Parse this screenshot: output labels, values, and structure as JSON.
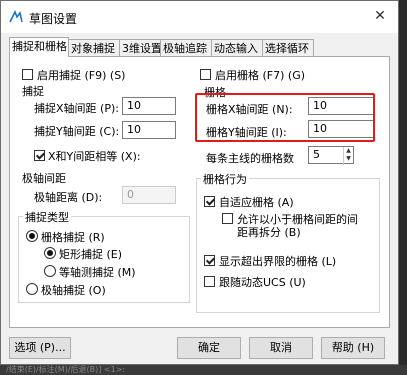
{
  "window": {
    "title": "草图设置",
    "close_label": "✕",
    "icon": "drafting-settings-icon"
  },
  "tabs": [
    {
      "label": "捕捉和栅格",
      "active": true
    },
    {
      "label": "对象捕捉",
      "active": false
    },
    {
      "label": "3维设置",
      "active": false
    },
    {
      "label": "极轴追踪",
      "active": false
    },
    {
      "label": "动态输入",
      "active": false
    },
    {
      "label": "选择循环",
      "active": false
    }
  ],
  "snap": {
    "enable_label": "启用捕捉 (F9) (S)",
    "enabled": false,
    "group_title": "捕捉",
    "x_spacing_label": "捕捉X轴间距 (P):",
    "x_spacing_value": "10",
    "y_spacing_label": "捕捉Y轴间距 (C):",
    "y_spacing_value": "10",
    "equal_label": "X和Y间距相等 (X):",
    "equal_checked": true
  },
  "polar": {
    "group_title": "极轴间距",
    "distance_label": "极轴距离 (D):",
    "distance_value": "0"
  },
  "snap_type": {
    "group_title": "捕捉类型",
    "grid_snap_label": "栅格捕捉 (R)",
    "rect_snap_label": "矩形捕捉 (E)",
    "iso_snap_label": "等轴测捕捉 (M)",
    "polar_snap_label": "极轴捕捉 (O)"
  },
  "grid": {
    "enable_label": "启用栅格 (F7) (G)",
    "enabled": false,
    "group_title": "栅格",
    "x_spacing_label": "栅格X轴间距 (N):",
    "x_spacing_value": "10",
    "y_spacing_label": "栅格Y轴间距 (I):",
    "y_spacing_value": "10",
    "major_label": "每条主线的栅格数",
    "major_value": "5"
  },
  "grid_behavior": {
    "group_title": "栅格行为",
    "adaptive_label": "自适应栅格 (A)",
    "adaptive_checked": true,
    "subdivide_label_1": "允许以小于栅格间距的间",
    "subdivide_label_2": "距再拆分 (B)",
    "subdivide_checked": false,
    "beyond_label": "显示超出界限的栅格 (L)",
    "beyond_checked": true,
    "follow_ucs_label": "跟随动态UCS (U)",
    "follow_ucs_checked": false
  },
  "buttons": {
    "options": "选项 (P)...",
    "ok": "确定",
    "cancel": "取消",
    "help": "帮助 (H)"
  },
  "background_text": "/结束(E)/标注(M)/后退(B)] <1>:"
}
